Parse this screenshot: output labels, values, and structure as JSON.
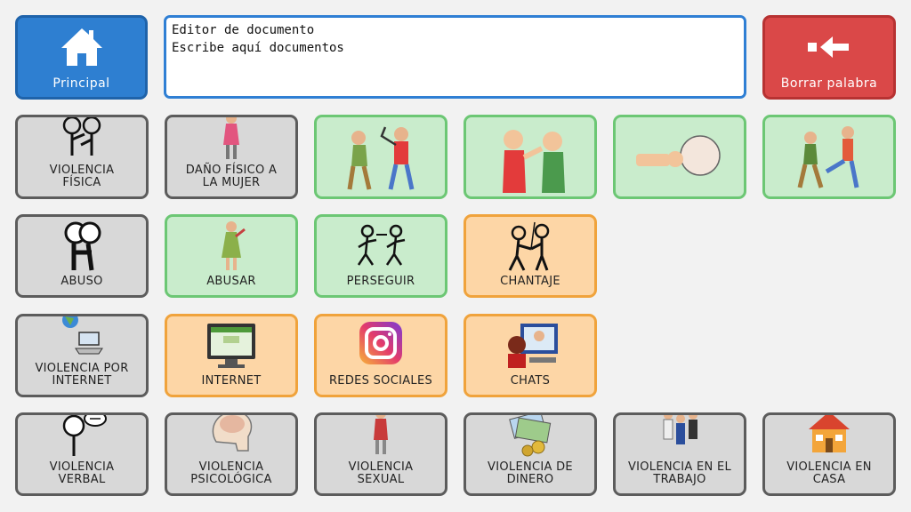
{
  "top": {
    "home_label": "Principal",
    "erase_label": "Borrar palabra",
    "editor_title": "Editor de documento",
    "editor_placeholder": "Escribe aquí documentos"
  },
  "colors": {
    "grey": "#d8d8d8",
    "green": "#c9eccc",
    "orange": "#fdd6a6",
    "home": "#2e7fd1",
    "erase": "#da4848"
  },
  "grid": {
    "row1": [
      {
        "label": "VIOLENCIA\nFÍSICA",
        "icon": "two-people-hitting-icon"
      },
      {
        "label": "DAÑO FÍSICO A\nLA MUJER",
        "icon": "woman-icon"
      },
      {
        "label": "",
        "icon": "man-hitting-with-stick-icon"
      },
      {
        "label": "",
        "icon": "man-punching-face-icon"
      },
      {
        "label": "",
        "icon": "fist-punching-head-icon"
      },
      {
        "label": "",
        "icon": "man-kicking-icon"
      }
    ],
    "row2": [
      {
        "label": "ABUSO",
        "icon": "abuse-icon"
      },
      {
        "label": "ABUSAR",
        "icon": "woman-abused-icon"
      },
      {
        "label": "PERSEGUIR",
        "icon": "chasing-icon"
      },
      {
        "label": "CHANTAJE",
        "icon": "blackmail-icon"
      }
    ],
    "row3": [
      {
        "label": "VIOLENCIA POR\nINTERNET",
        "icon": "globe-computer-icon"
      },
      {
        "label": "INTERNET",
        "icon": "monitor-icon"
      },
      {
        "label": "REDES SOCIALES",
        "icon": "instagram-icon"
      },
      {
        "label": "CHATS",
        "icon": "chat-video-icon"
      }
    ],
    "row4": [
      {
        "label": "VIOLENCIA\nVERBAL",
        "icon": "verbal-violence-icon"
      },
      {
        "label": "VIOLENCIA\nPSICOLÓGICA",
        "icon": "brain-head-icon"
      },
      {
        "label": "VIOLENCIA\nSEXUAL",
        "icon": "woman-standing-icon"
      },
      {
        "label": "VIOLENCIA DE\nDINERO",
        "icon": "money-icon"
      },
      {
        "label": "VIOLENCIA EN EL\nTRABAJO",
        "icon": "workers-icon"
      },
      {
        "label": "VIOLENCIA EN\nCASA",
        "icon": "house-icon"
      }
    ]
  }
}
